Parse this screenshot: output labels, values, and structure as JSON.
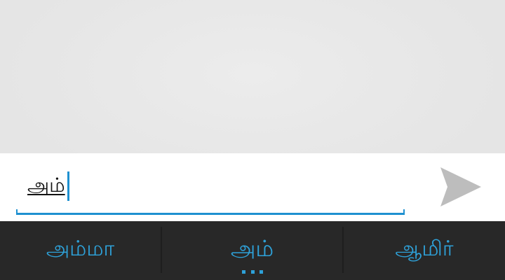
{
  "compose": {
    "input_value": "அம்",
    "send_icon": "send-icon"
  },
  "suggestions": [
    {
      "label": "அம்மா"
    },
    {
      "label": "அம்"
    },
    {
      "label": "ஆமிர்"
    }
  ],
  "colors": {
    "accent": "#2ea1d8",
    "cursor": "#1e90d0",
    "suggestion_bar": "#282828",
    "content_bg": "#e8e8e8",
    "send_icon": "#bdbdbd"
  }
}
